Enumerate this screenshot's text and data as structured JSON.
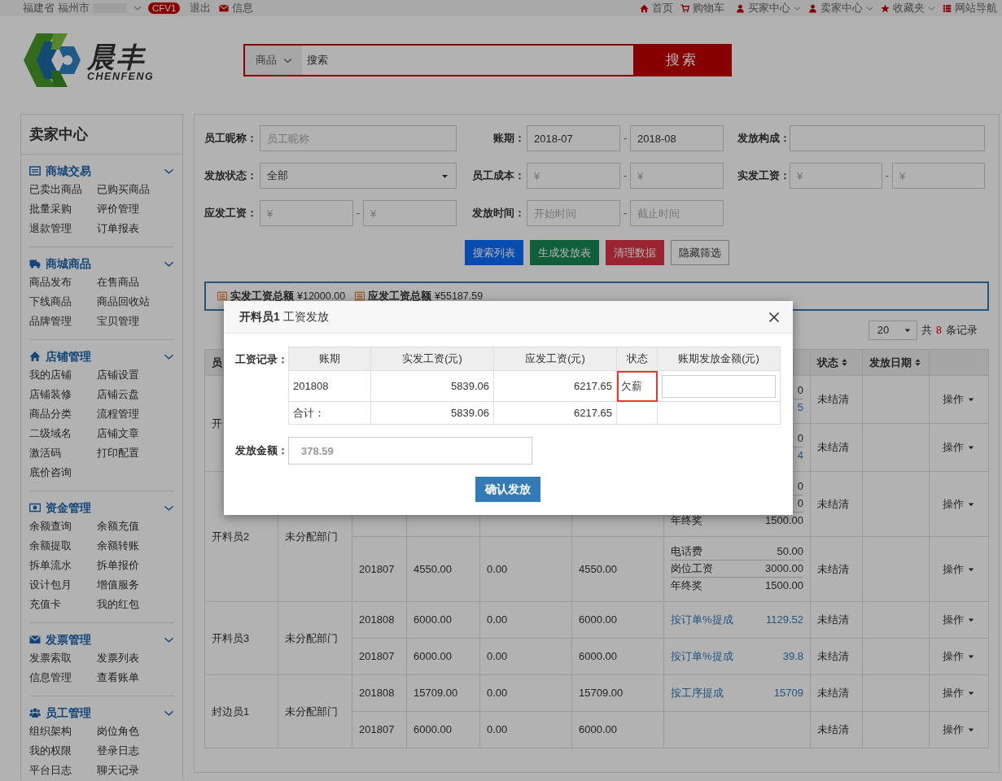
{
  "topbar": {
    "location": [
      "福建省",
      "福州市"
    ],
    "badge": "CFV1",
    "logout": "退出",
    "messages": "信息",
    "links": [
      {
        "label": "首页",
        "dropdown": false
      },
      {
        "label": "购物车",
        "dropdown": false
      },
      {
        "label": "买家中心",
        "dropdown": true
      },
      {
        "label": "卖家中心",
        "dropdown": true
      },
      {
        "label": "收藏夹",
        "dropdown": true
      },
      {
        "label": "网站导航",
        "dropdown": false
      }
    ]
  },
  "logo": {
    "name": "晨丰",
    "latin": "CHENFENG"
  },
  "search": {
    "category": "商品",
    "placeholder": "搜索",
    "button": "搜索"
  },
  "sidebar": {
    "title": "卖家中心",
    "sections": [
      {
        "title": "商城交易",
        "expanded": true,
        "items": [
          "已卖出商品",
          "已购买商品",
          "批量采购",
          "评价管理",
          "退款管理",
          "订单报表"
        ]
      },
      {
        "title": "商城商品",
        "expanded": true,
        "items": [
          "商品发布",
          "在售商品",
          "下线商品",
          "商品回收站",
          "品牌管理",
          "宝贝管理"
        ]
      },
      {
        "title": "店铺管理",
        "expanded": true,
        "items": [
          "我的店铺",
          "店铺设置",
          "店铺装修",
          "店铺云盘",
          "商品分类",
          "流程管理",
          "二级域名",
          "店铺文章",
          "激活码",
          "打印配置",
          "底价咨询"
        ]
      },
      {
        "title": "资金管理",
        "expanded": true,
        "items": [
          "余额查询",
          "余额充值",
          "余额提取",
          "余额转账",
          "拆单流水",
          "拆单报价",
          "设计包月",
          "增值服务",
          "充值卡",
          "我的红包"
        ]
      },
      {
        "title": "发票管理",
        "expanded": true,
        "items": [
          "发票索取",
          "发票列表",
          "信息管理",
          "查看账单"
        ]
      },
      {
        "title": "员工管理",
        "expanded": true,
        "items": [
          "组织架构",
          "岗位角色",
          "我的权限",
          "登录日志",
          "平台日志",
          "聊天记录"
        ]
      }
    ]
  },
  "filters": [
    {
      "label": "员工昵称：",
      "kind": "text",
      "placeholder": "员工昵称"
    },
    {
      "label": "账期：",
      "kind": "range",
      "separator": "-",
      "from": {
        "value": "2018-07"
      },
      "to": {
        "value": "2018-08"
      }
    },
    {
      "label": "发放构成：",
      "kind": "text"
    },
    {
      "label": "发放状态：",
      "kind": "select",
      "value": "全部"
    },
    {
      "label": "员工成本：",
      "kind": "range",
      "separator": "-",
      "from": {
        "placeholder": "¥"
      },
      "to": {
        "placeholder": "¥"
      }
    },
    {
      "label": "实发工资：",
      "kind": "range",
      "separator": "-",
      "from": {
        "placeholder": "¥"
      },
      "to": {
        "placeholder": "¥"
      }
    },
    {
      "label": "应发工资：",
      "kind": "range",
      "separator": "-",
      "from": {
        "placeholder": "¥"
      },
      "to": {
        "placeholder": "¥"
      }
    },
    {
      "label": "发放时间：",
      "kind": "range",
      "separator": "-",
      "from": {
        "placeholder": "开始时间"
      },
      "to": {
        "placeholder": "截止时间"
      }
    }
  ],
  "actions": [
    {
      "label": "搜索列表",
      "kind": "primary"
    },
    {
      "label": "生成发放表",
      "kind": "success"
    },
    {
      "label": "清理数据",
      "kind": "danger"
    },
    {
      "label": "隐藏筛选",
      "kind": "default"
    }
  ],
  "totals": [
    {
      "label": "实发工资总额",
      "value": "¥12000.00"
    },
    {
      "label": "应发工资总额",
      "value": "¥55187.59"
    }
  ],
  "pager": {
    "page_size": "20",
    "prefix": "共",
    "count": "8",
    "suffix": "条记录"
  },
  "table_header": {
    "column_1": {
      "label": "员"
    },
    "status": {
      "label": "状态",
      "sortable": true
    },
    "pay_date": {
      "label": "发放日期",
      "sortable": true
    }
  },
  "employees": [
    {
      "name": "开",
      "records": [
        {
          "details": [
            {
              "amount": "0",
              "link": false
            },
            {
              "amount": "5",
              "link": true
            }
          ],
          "status": "未结清",
          "action": "操作"
        },
        {
          "details": [
            {
              "amount": "0",
              "link": false
            },
            {
              "amount": "4",
              "link": true
            }
          ],
          "status": "未结清",
          "action": "操作"
        }
      ]
    },
    {
      "name": "开料员2",
      "department": "未分配部门",
      "records": [
        {
          "details": [
            {
              "amount": "0",
              "link": false
            },
            {
              "amount": "0",
              "link": false
            },
            {
              "label": "年终奖",
              "amount": "1500.00",
              "link": false
            }
          ],
          "status": "未结清",
          "action": "操作"
        },
        {
          "period": "201807",
          "actual": "4550.00",
          "column_5": "0.00",
          "payable": "4550.00",
          "details": [
            {
              "label": "电话费",
              "amount": "50.00",
              "link": false
            },
            {
              "label": "岗位工资",
              "amount": "3000.00",
              "link": false
            },
            {
              "label": "年终奖",
              "amount": "1500.00",
              "link": false
            }
          ],
          "status": "未结清",
          "action": "操作"
        }
      ]
    },
    {
      "name": "开料员3",
      "department": "未分配部门",
      "records": [
        {
          "period": "201808",
          "actual": "6000.00",
          "column_5": "0.00",
          "payable": "6000.00",
          "details": [
            {
              "label": "按订单%提成",
              "amount": "1129.52",
              "link": true
            }
          ],
          "status": "未结清",
          "action": "操作"
        },
        {
          "period": "201807",
          "actual": "6000.00",
          "column_5": "0.00",
          "payable": "6000.00",
          "details": [
            {
              "label": "按订单%提成",
              "amount": "39.8",
              "link": true
            }
          ],
          "status": "未结清",
          "action": "操作"
        }
      ]
    },
    {
      "name": "封边员1",
      "department": "未分配部门",
      "records": [
        {
          "period": "201808",
          "actual": "15709.00",
          "column_5": "0.00",
          "payable": "15709.00",
          "details": [
            {
              "label": "按工序提成",
              "amount": "15709",
              "link": true
            }
          ],
          "status": "未结清",
          "action": "操作"
        },
        {
          "period": "201807",
          "actual": "6000.00",
          "column_5": "0.00",
          "payable": "6000.00",
          "status": "未结清",
          "action": "操作"
        }
      ]
    }
  ],
  "modal": {
    "title": "**开料员1** 工资发放",
    "records_label": "工资记录：",
    "columns": [
      "账期",
      "实发工资(元)",
      "应发工资(元)",
      "状态",
      "账期发放金额(元)"
    ],
    "rows": [
      {
        "period": "201808",
        "actual": "5839.06",
        "payable": "6217.65",
        "status": "欠薪",
        "highlighted": true
      }
    ],
    "total": {
      "label": "合计：",
      "actual": "5839.06",
      "payable": "6217.65"
    },
    "amount_label": "发放金额：",
    "amount": "378.59",
    "confirm": "确认发放"
  }
}
